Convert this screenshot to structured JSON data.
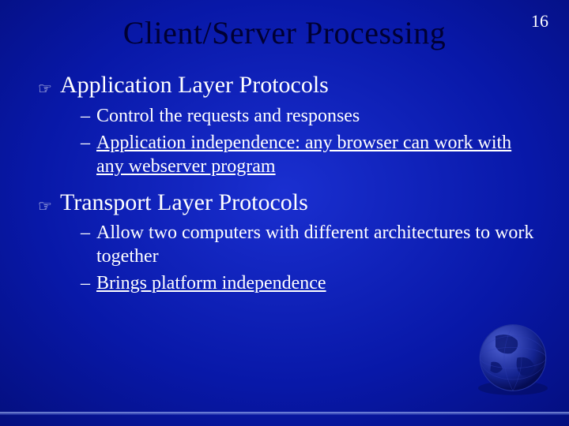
{
  "page_number": "16",
  "title": "Client/Server Processing",
  "sections": [
    {
      "heading": "Application Layer Protocols",
      "items": [
        {
          "plain": "Control the requests and responses",
          "underlined": ""
        },
        {
          "plain": "",
          "underlined": "Application independence:  any browser can work with any webserver program"
        }
      ]
    },
    {
      "heading": "Transport Layer Protocols",
      "items": [
        {
          "plain": "Allow two computers with different architectures to work together",
          "underlined": ""
        },
        {
          "plain": "",
          "underlined": "Brings platform independence"
        }
      ]
    }
  ]
}
